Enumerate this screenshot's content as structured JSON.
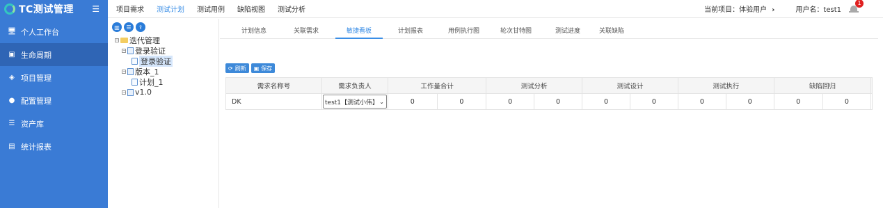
{
  "brand": {
    "title": "TC测试管理",
    "accent": "#3a7bd5"
  },
  "sidebar": {
    "items": [
      {
        "label": "个人工作台",
        "icon": "desktop-icon",
        "glyph": "🖥"
      },
      {
        "label": "生命周期",
        "icon": "lifecycle-icon",
        "glyph": "▣",
        "active": true
      },
      {
        "label": "项目管理",
        "icon": "layers-icon",
        "glyph": "◈"
      },
      {
        "label": "配置管理",
        "icon": "settings-icon",
        "glyph": "●"
      },
      {
        "label": "资产库",
        "icon": "database-icon",
        "glyph": "☰"
      },
      {
        "label": "统计报表",
        "icon": "report-icon",
        "glyph": "▤"
      }
    ]
  },
  "topbar": {
    "tabs": [
      "项目需求",
      "测试计划",
      "测试用例",
      "缺陷视图",
      "测试分析"
    ],
    "active_tab": "测试计划",
    "current_project_label": "当前项目：体验用户",
    "user_label": "用户名：test1",
    "notification_count": "1"
  },
  "tree": {
    "nodes": [
      {
        "label": "迭代管理",
        "level": 0,
        "kind": "folder",
        "expandable": true
      },
      {
        "label": "登录验证",
        "level": 1,
        "kind": "doc",
        "expandable": true
      },
      {
        "label": "登录验证",
        "level": 2,
        "kind": "leaf",
        "selected": true
      },
      {
        "label": "版本_1",
        "level": 1,
        "kind": "doc",
        "expandable": true
      },
      {
        "label": "计划_1",
        "level": 2,
        "kind": "leaf"
      },
      {
        "label": "v1.0",
        "level": 1,
        "kind": "doc",
        "expandable": true
      }
    ]
  },
  "subtabs": {
    "items": [
      "计划信息",
      "关联需求",
      "敏捷看板",
      "计划报表",
      "用例执行图",
      "轮次甘特图",
      "测试进度",
      "关联缺陷"
    ],
    "active": "敏捷看板"
  },
  "actions": {
    "refresh_label": "刷新",
    "save_label": "保存"
  },
  "grid": {
    "headers": [
      "需求名称号",
      "需求负责人",
      "工作量合计",
      "测试分析",
      "测试设计",
      "测试执行",
      "缺陷回归"
    ],
    "rows": [
      {
        "name": "DK",
        "owner": "test1【测试小伟】",
        "values": [
          "0",
          "0",
          "0",
          "0",
          "0",
          "0",
          "0",
          "0",
          "0",
          "0"
        ]
      }
    ]
  }
}
